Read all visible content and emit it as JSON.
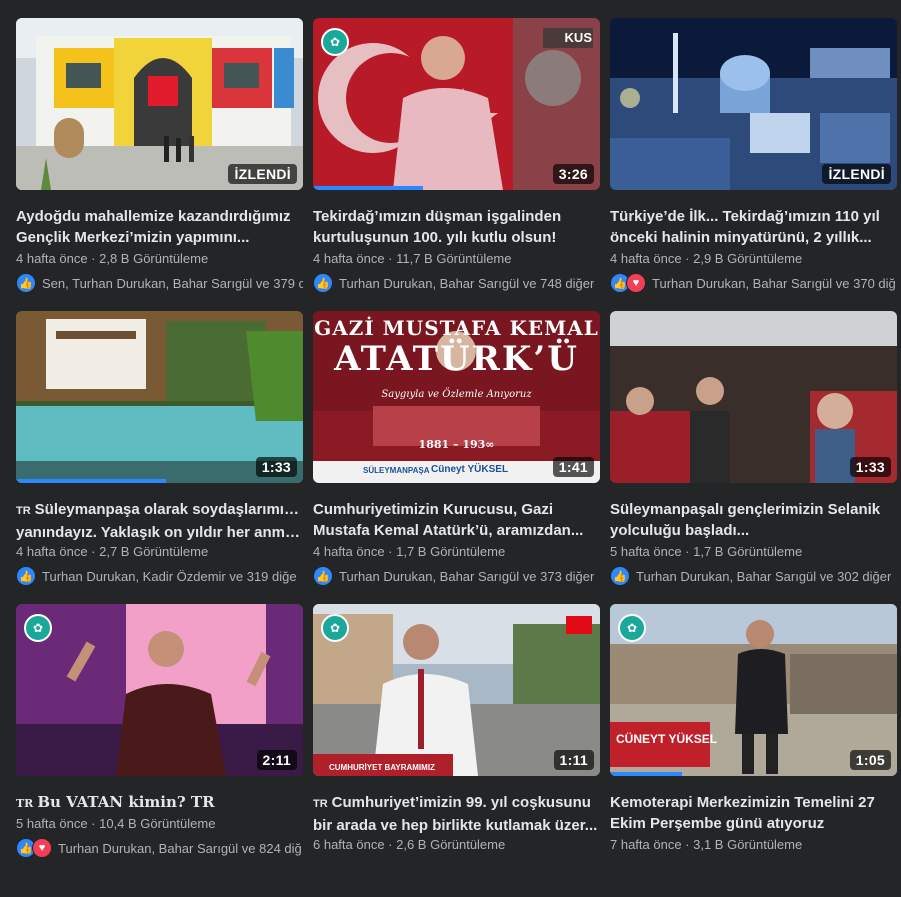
{
  "videos": [
    {
      "title1": "Aydoğdu mahallemize kazandırdığımız",
      "title2": "Gençlik Merkezi’mizin yapımını...",
      "meta": "4 hafta önce · 2,8 B Görüntüleme",
      "reactions": "Sen, Turhan Durukan, Bahar Sarıgül ve 379 c",
      "badge": "İZLENDİ",
      "flag": "",
      "love": false
    },
    {
      "title1": "Tekirdağ’ımızın düşman işgalinden",
      "title2": "kurtuluşunun 100. yılı kutlu olsun!",
      "meta": "4 hafta önce · 11,7 B Görüntüleme",
      "reactions": "Turhan Durukan, Bahar Sarıgül ve 748 diğer",
      "badge": "3:26",
      "flag": "",
      "love": false
    },
    {
      "title1": "Türkiye’de İlk... Tekirdağ’ımızın 110 yıl",
      "title2": "önceki halinin minyatürünü, 2 yıllık...",
      "meta": "4 hafta önce · 2,9 B Görüntüleme",
      "reactions": "Turhan Durukan, Bahar Sarıgül ve 370 diğ",
      "badge": "İZLENDİ",
      "flag": "",
      "love": true
    },
    {
      "title1": "Süleymanpaşa olarak soydaşlarımızın",
      "title2": "yanındayız. Yaklaşık on yıldır her anma...",
      "meta": "4 hafta önce · 2,7 B Görüntüleme",
      "reactions": "Turhan Durukan, Kadir Özdemir ve 319 diğe",
      "badge": "1:33",
      "flag": "TR",
      "love": false
    },
    {
      "title1": "Cumhuriyetimizin Kurucusu, Gazi",
      "title2": "Mustafa Kemal Atatürk’ü, aramızdan...",
      "meta": "4 hafta önce · 1,7 B Görüntüleme",
      "reactions": "Turhan Durukan, Bahar Sarıgül ve 373 diğer",
      "badge": "1:41",
      "flag": "",
      "love": false
    },
    {
      "title1": "Süleymanpaşalı gençlerimizin Selanik",
      "title2": "yolculuğu başladı...",
      "meta": "5 hafta önce · 1,7 B Görüntüleme",
      "reactions": "Turhan Durukan, Bahar Sarıgül ve 302 diğer",
      "badge": "1:33",
      "flag": "",
      "love": false
    },
    {
      "title1": "Bu VATAN kimin? TR",
      "title2": "",
      "meta": "5 hafta önce · 10,4 B Görüntüleme",
      "reactions": "Turhan Durukan, Bahar Sarıgül ve 824 diğ",
      "badge": "2:11",
      "flag": "TR",
      "love": true
    },
    {
      "title1": "Cumhuriyet’imizin 99. yıl coşkusunu",
      "title2": "bir arada ve hep birlikte kutlamak üzer...",
      "meta": "6 hafta önce · 2,6 B Görüntüleme",
      "reactions": "",
      "badge": "1:11",
      "flag": "TR",
      "love": false
    },
    {
      "title1": "Kemoterapi Merkezimizin Temelini 27",
      "title2": "Ekim Perşembe günü atıyoruz",
      "meta": "7 hafta önce · 3,1 B Görüntüleme",
      "reactions": "",
      "badge": "1:05",
      "flag": "",
      "love": false
    }
  ],
  "thumb_text": {
    "gazi": "GAZİ MUSTAFA KEMAL",
    "ataturk": "ATATÜRK’Ü",
    "saygi": "Saygıyla ve Özlemle Anıyoruz",
    "years": "1881 – 193∞",
    "brand1": "SÜLEYMANPAŞA",
    "brand2": "Cüneyt YÜKSEL",
    "cuneyt": "CÜNEYT YÜKSEL",
    "bayram": "CUMHURİYET BAYRAMIMIZ",
    "kus": "KUS"
  },
  "colors": {
    "background": "#242526",
    "accent": "#2d88ff",
    "love": "#f33e58"
  }
}
